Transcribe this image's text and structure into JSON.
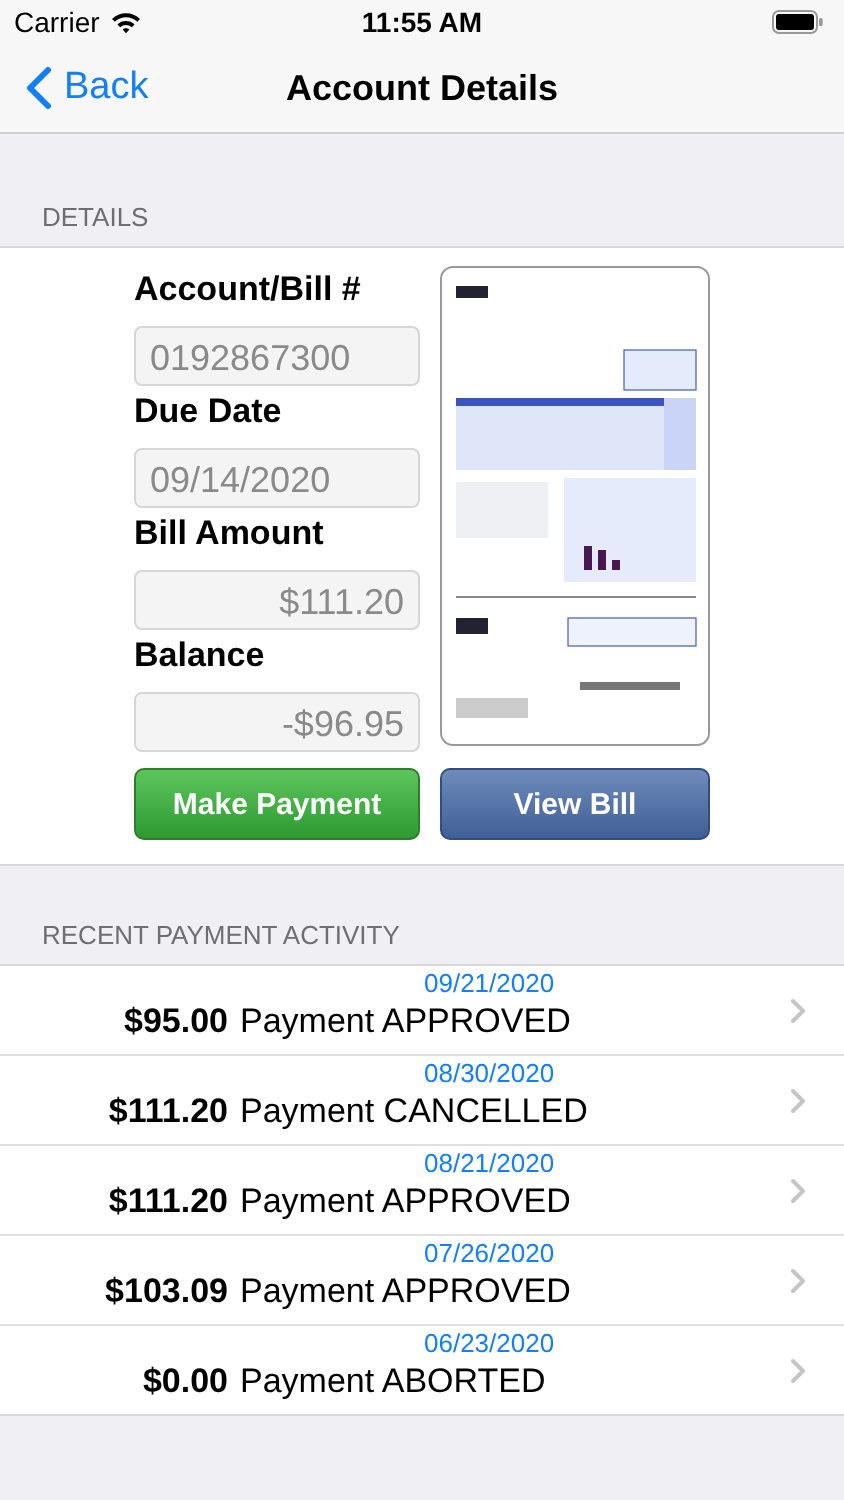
{
  "status_bar": {
    "carrier": "Carrier",
    "time": "11:55 AM"
  },
  "nav": {
    "back": "Back",
    "title": "Account Details"
  },
  "details": {
    "header": "DETAILS",
    "fields": [
      {
        "label": "Account/Bill #",
        "value": "0192867300",
        "kind": "text"
      },
      {
        "label": "Due Date",
        "value": "09/14/2020",
        "kind": "text"
      },
      {
        "label": "Bill Amount",
        "value": "$111.20",
        "kind": "currency"
      },
      {
        "label": "Balance",
        "value": "-$96.95",
        "kind": "currency"
      }
    ],
    "buttons": [
      {
        "label": "Make Payment",
        "kind": "primary"
      },
      {
        "label": "View Bill",
        "kind": "secondary"
      }
    ]
  },
  "activity": {
    "header": "RECENT PAYMENT ACTIVITY",
    "rows": [
      {
        "amount": "$95.00",
        "status": "Payment APPROVED",
        "date": "09/21/2020"
      },
      {
        "amount": "$111.20",
        "status": "Payment CANCELLED",
        "date": "08/30/2020"
      },
      {
        "amount": "$111.20",
        "status": "Payment APPROVED",
        "date": "08/21/2020"
      },
      {
        "amount": "$103.09",
        "status": "Payment APPROVED",
        "date": "07/26/2020"
      },
      {
        "amount": "$0.00",
        "status": "Payment ABORTED",
        "date": "06/23/2020"
      }
    ]
  }
}
